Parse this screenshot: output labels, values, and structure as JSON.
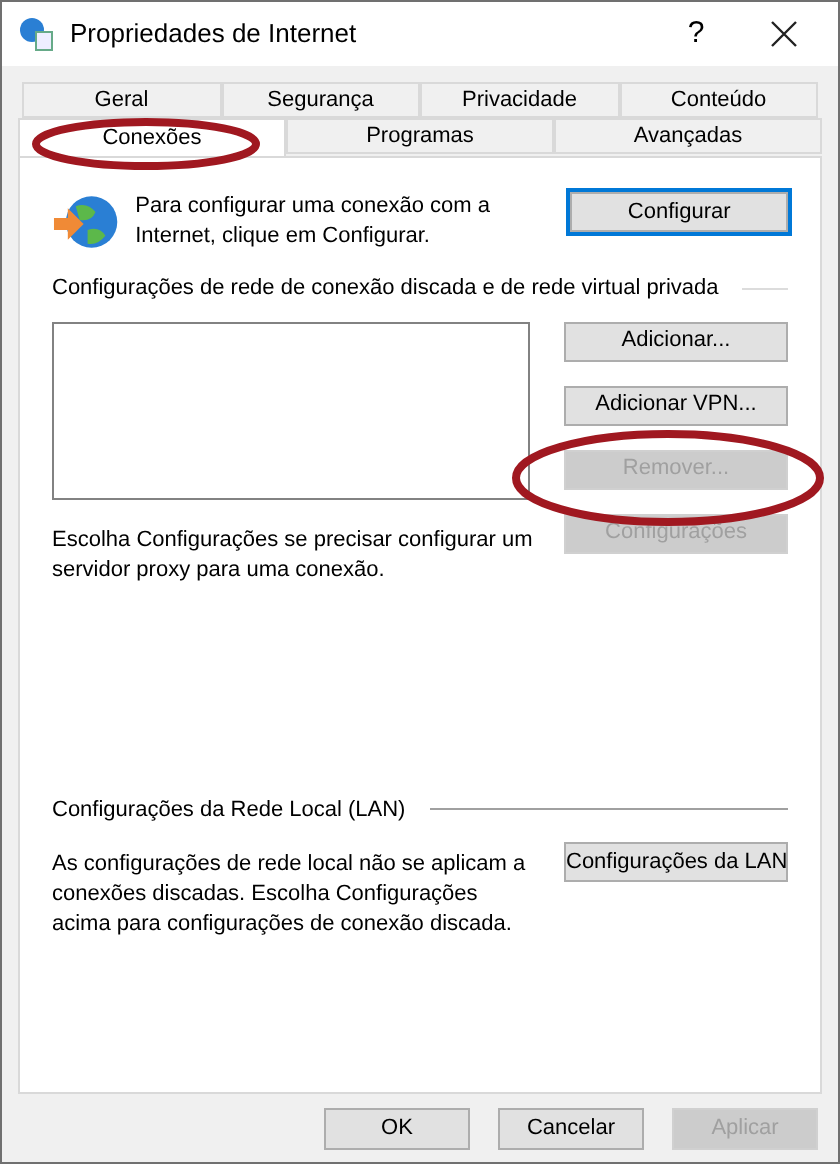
{
  "window": {
    "title": "Propriedades de Internet",
    "help": "?"
  },
  "tab_rows": [
    [
      {
        "label": "Geral",
        "selected": false
      },
      {
        "label": "Segurança",
        "selected": false
      },
      {
        "label": "Privacidade",
        "selected": false
      },
      {
        "label": "Conteúdo",
        "selected": false
      }
    ],
    [
      {
        "label": "Conexões",
        "selected": true
      },
      {
        "label": "Programas",
        "selected": false
      },
      {
        "label": "Avançadas",
        "selected": false
      }
    ]
  ],
  "setup": {
    "text": "Para configurar uma conexão com a Internet, clique em Configurar.",
    "button": {
      "label": "Configurar",
      "disabled": false,
      "focused": true
    }
  },
  "dialup": {
    "heading": "Configurações de rede de conexão discada e de rede virtual privada",
    "buttons": [
      {
        "label": "Adicionar...",
        "disabled": false
      },
      {
        "label": "Adicionar VPN...",
        "disabled": false
      },
      {
        "label": "Remover...",
        "disabled": true
      },
      {
        "label": "Configurações",
        "disabled": true
      }
    ],
    "proxy_text": "Escolha Configurações se precisar configurar um servidor proxy para uma conexão."
  },
  "lan": {
    "heading": "Configurações da Rede Local (LAN)",
    "text": "As configurações de rede local não se aplicam a conexões discadas. Escolha Configurações acima para configurações de conexão discada.",
    "button": {
      "label": "Configurações da LAN",
      "disabled": false
    }
  },
  "footer_buttons": [
    {
      "label": "OK",
      "disabled": false
    },
    {
      "label": "Cancelar",
      "disabled": false
    },
    {
      "label": "Aplicar",
      "disabled": true
    }
  ]
}
